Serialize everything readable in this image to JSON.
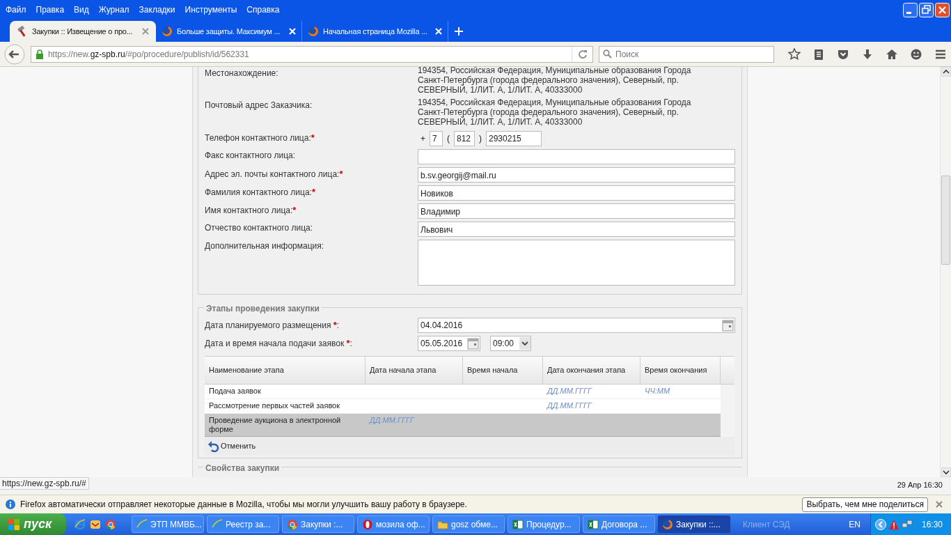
{
  "menu": [
    "Файл",
    "Правка",
    "Вид",
    "Журнал",
    "Закладки",
    "Инструменты",
    "Справка"
  ],
  "tabs": [
    {
      "title": "Закупки :: Извещение о про...",
      "selected": true,
      "kind": "gavel"
    },
    {
      "title": "Больше защиты. Максимум ...",
      "selected": false,
      "kind": "firefox"
    },
    {
      "title": "Начальная страница Mozilla ...",
      "selected": false,
      "kind": "firefox"
    }
  ],
  "address_bar": {
    "prefix": "https://new.",
    "domain": "gz-spb.ru",
    "path": "/#po/procedure/publish/id/562331"
  },
  "search": {
    "placeholder": "Поиск"
  },
  "contact_fields": [
    {
      "kind": "static",
      "label": "Местонахождение:",
      "value": "194354, Российская Федерация, Муниципальные образования Города Санкт-Петербурга (города федерального значения), Северный, пр. СЕВЕРНЫЙ, 1/ЛИТ. А, 1/ЛИТ. А, 40333000"
    },
    {
      "kind": "static",
      "label": "Почтовый адрес Заказчика:",
      "value": "194354, Российская Федерация, Муниципальные образования Города Санкт-Петербурга (города федерального значения), Северный, пр. СЕВЕРНЫЙ, 1/ЛИТ. А, 1/ЛИТ. А, 40333000"
    },
    {
      "kind": "phone",
      "label": "Телефон контактного лица:",
      "required_mark": "*",
      "plus": "+",
      "country": "7",
      "open": "(",
      "area": "812",
      "close": ")",
      "number": "2930215"
    },
    {
      "kind": "input",
      "label": "Факс контактного лица:"
    },
    {
      "kind": "input",
      "label": "Адрес эл. почты контактного лица:",
      "required_mark": "*",
      "value": "b.sv.georgij@mail.ru"
    },
    {
      "kind": "input",
      "label": "Фамилия контактного лица:",
      "required_mark": "*",
      "value": "Новиков"
    },
    {
      "kind": "input",
      "label": "Имя контактного лица:",
      "required_mark": "*",
      "value": "Владимир"
    },
    {
      "kind": "input",
      "label": "Отчество контактного лица:",
      "value": "Львович"
    },
    {
      "kind": "textarea",
      "label": "Дополнительная информация:"
    }
  ],
  "stages": {
    "legend": "Этапы проведения закупки",
    "planned_date": {
      "label": "Дата планируемого размещения ",
      "required_mark": "*",
      "label_end": ":",
      "value": "04.04.2016"
    },
    "start": {
      "label": "Дата и время начала подачи заявок ",
      "required_mark": "*",
      "label_end": ":",
      "date": "05.05.2016",
      "time": "09:00"
    },
    "columns": [
      "Наименование этапа",
      "Дата начала этапа",
      "Время начала",
      "Дата окончания этапа",
      "Время окончания"
    ],
    "rows": [
      {
        "name": "Подача заявок",
        "end_date": "ДД.ММ.ГГГГ",
        "end_time": "ЧЧ:ММ",
        "selected": false
      },
      {
        "name": "Рассмотрение первых частей заявок",
        "end_date": "ДД.ММ.ГГГГ",
        "selected": false
      },
      {
        "name": "Проведение аукциона в электронной форме",
        "start_date": "ДД.ММ.ГГГГ",
        "selected": true
      }
    ],
    "cancel": "Отменить"
  },
  "next_legend": "Свойства закупки",
  "status_url": "https://new.gz-spb.ru/#",
  "page_datetime": "29 Апр 16:30",
  "notification": {
    "text": "Firefox автоматически отправляет некоторые данные в Mozilla, чтобы мы могли улучшить вашу работу в браузере.",
    "button": "Выбрать, чем мне поделиться"
  },
  "taskbar": {
    "start": "пуск",
    "items": [
      {
        "kind": "ie",
        "label": "ЭТП ММВБ...",
        "selected": false
      },
      {
        "kind": "ie",
        "label": "Реестр за...",
        "selected": false
      },
      {
        "kind": "chrome",
        "label": "Закупки :...",
        "selected": false
      },
      {
        "kind": "opera",
        "label": "мозила оф...",
        "selected": false
      },
      {
        "kind": "folder",
        "label": "gosz обме...",
        "selected": false
      },
      {
        "kind": "excel",
        "label": "Процедур...",
        "selected": false
      },
      {
        "kind": "excel",
        "label": "Договора ...",
        "selected": false
      },
      {
        "kind": "firefox",
        "label": "Закупки ::...",
        "selected": true
      }
    ],
    "extra": "Клиент СЭД",
    "lang": "EN",
    "clock": "16:30"
  }
}
